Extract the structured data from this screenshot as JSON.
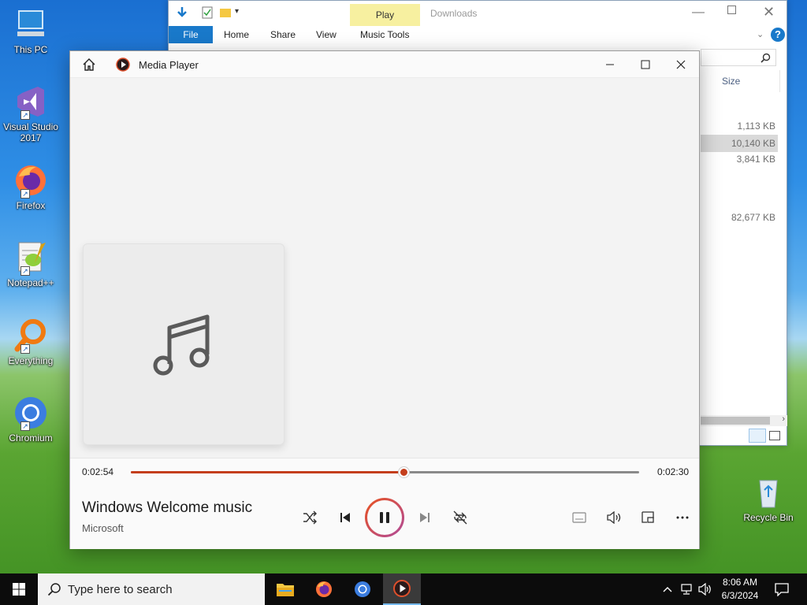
{
  "desktop": {
    "icons": [
      {
        "label": "This PC"
      },
      {
        "label": "Visual Studio 2017"
      },
      {
        "label": "Firefox"
      },
      {
        "label": "Notepad++"
      },
      {
        "label": "Everything"
      },
      {
        "label": "Chromium"
      },
      {
        "label": "Recycle Bin"
      }
    ]
  },
  "explorer": {
    "title": "Downloads",
    "context_tab": "Play",
    "tabs": [
      "File",
      "Home",
      "Share",
      "View",
      "Music Tools"
    ],
    "column_header": "Size",
    "sizes": [
      "1,113 KB",
      "10,140 KB",
      "3,841 KB",
      "82,677 KB"
    ]
  },
  "media_player": {
    "title": "Media Player",
    "elapsed": "0:02:54",
    "remaining": "0:02:30",
    "progress": 0.537,
    "song_title": "Windows Welcome music",
    "artist": "Microsoft"
  },
  "taskbar": {
    "search_placeholder": "Type here to search",
    "time": "8:06 AM",
    "date": "6/3/2024"
  },
  "colors": {
    "accent": "#c43e1c",
    "explorer_file_tab": "#1979ca",
    "play_tab": "#f7f0a0"
  }
}
